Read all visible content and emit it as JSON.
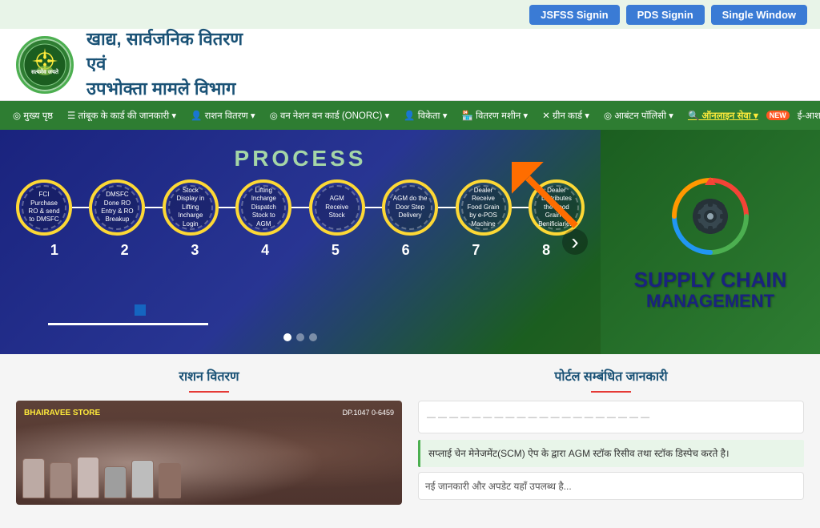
{
  "topbar": {
    "buttons": {
      "jsfss": "JSFSS Signin",
      "pds": "PDS Signin",
      "single": "Single Window"
    }
  },
  "header": {
    "title_line1": "खाद्य, सार्वजनिक वितरण",
    "title_line2": "एवं",
    "title_line3": "उपभोक्ता मामले विभाग"
  },
  "nav": {
    "items": [
      {
        "label": "◎ मुख्य पृष्ठ",
        "id": "home"
      },
      {
        "label": "☰ तांबूक के कार्ड की जानकारी ▾",
        "id": "card-info"
      },
      {
        "label": "👤 राशन वितरण ▾",
        "id": "ration"
      },
      {
        "label": "◎ वन नेशन वन कार्ड (ONORC) ▾",
        "id": "onorc"
      },
      {
        "label": "👤 विकेता ▾",
        "id": "vendor"
      },
      {
        "label": "🏪 वितरण मशीन ▾",
        "id": "machine"
      },
      {
        "label": "✕ ग्रीन कार्ड ▾",
        "id": "green"
      },
      {
        "label": "◎ आबंटन पॉलिसी ▾",
        "id": "policy"
      },
      {
        "label": "🔍 ऑनलाइन सेवा ▾",
        "id": "online",
        "highlight": true
      },
      {
        "label": "NEW",
        "id": "new-badge"
      },
      {
        "label": "ई-आश",
        "id": "eaash"
      }
    ]
  },
  "banner": {
    "process_title": "PROCESS",
    "steps": [
      {
        "number": "1",
        "text": "FCI Purchase RO & send to DMSFC"
      },
      {
        "number": "2",
        "text": "DMSFC Done RO Entry & RO Breakup"
      },
      {
        "number": "3",
        "text": "Stock Display in Lifting Incharge Login"
      },
      {
        "number": "4",
        "text": "Lifting Incharge Dispatch Stock to AGM"
      },
      {
        "number": "5",
        "text": "AGM Receive Stock"
      },
      {
        "number": "6",
        "text": "AGM do the Door Step Delivery"
      },
      {
        "number": "7",
        "text": "Dealer Receive Food Grain by e-POS Machine"
      },
      {
        "number": "8",
        "text": "Dealer Distributes the Food Grain to Benificiaries."
      }
    ],
    "supply_chain": "SUPPLY CHAIN MANAGEMENT",
    "carousel_dots": [
      {
        "active": true
      },
      {
        "active": false
      },
      {
        "active": false
      }
    ]
  },
  "content": {
    "ration_title": "राशन वितरण",
    "portal_title": "पोर्टल सम्बंधित जानकारी",
    "portal_items": [
      "सप्लाई चेन मेनेजमेंट(SCM) ऐप के द्वारा AGM स्टॉक रिसीव तथा स्टॉक डिस्पेच करते है।",
      "नई जानकारी..."
    ]
  }
}
